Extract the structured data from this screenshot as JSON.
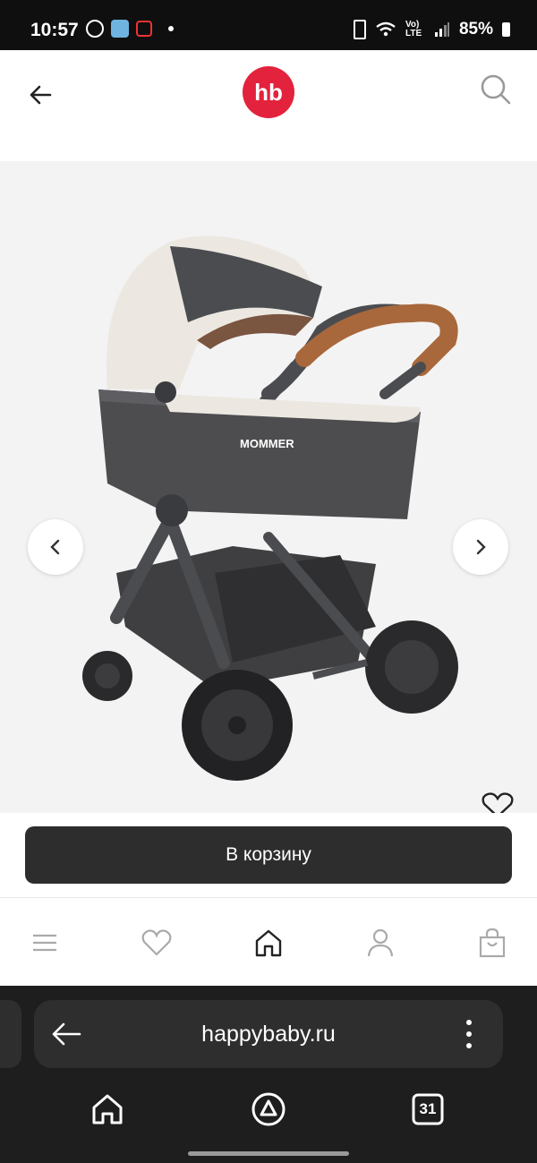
{
  "status_bar": {
    "time": "10:57",
    "battery": "85%",
    "network": "Vo) LTE"
  },
  "header": {
    "logo_text": "hb"
  },
  "product": {
    "brand_text": "MOMMER",
    "image_alt": "baby-stroller"
  },
  "actions": {
    "cart_label": "В корзину"
  },
  "browser": {
    "url": "happybaby.ru",
    "calendar_day": "31"
  },
  "colors": {
    "brand": "#e3223d",
    "button": "#2d2d2d",
    "browser_bg": "#1e1e1e"
  },
  "icons": [
    "back-arrow-icon",
    "search-icon",
    "chevron-left-icon",
    "chevron-right-icon",
    "heart-icon",
    "menu-icon",
    "home-icon",
    "profile-icon",
    "bag-icon",
    "more-icon",
    "assistant-icon",
    "calendar-icon"
  ]
}
